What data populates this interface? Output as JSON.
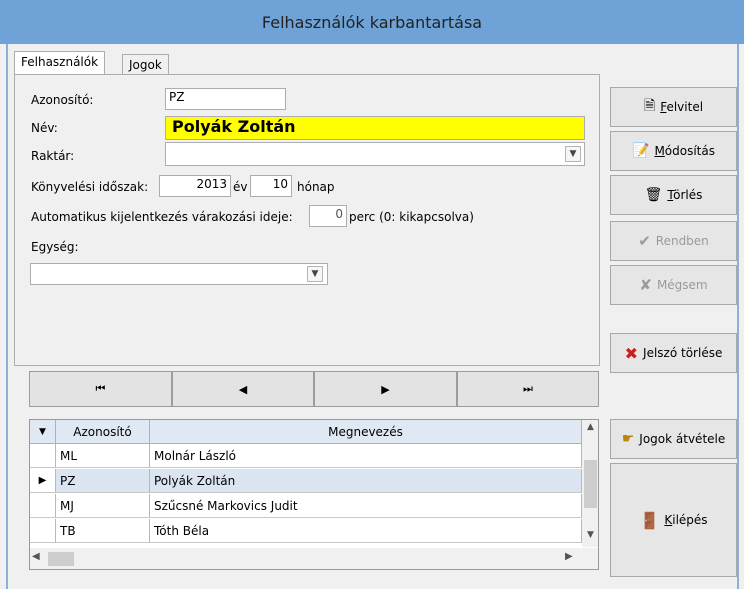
{
  "window": {
    "title": "Felhasználók karbantartása"
  },
  "tabs": {
    "users": "Felhasználók",
    "rights": "Jogok"
  },
  "form": {
    "id_label": "Azonosító:",
    "id_value": "PZ",
    "name_label": "Név:",
    "name_value": "Polyák Zoltán",
    "warehouse_label": "Raktár:",
    "warehouse_value": "",
    "period_label": "Könyvelési időszak:",
    "year_value": "2013",
    "year_unit": "év",
    "month_value": "10",
    "month_unit": "hónap",
    "logout_label": "Automatikus kijelentkezés várakozási ideje:",
    "logout_value": "0",
    "logout_unit": "perc (0: kikapcsolva)",
    "unit_label": "Egység:",
    "unit_value": ""
  },
  "buttons": {
    "add": {
      "u": "F",
      "rest": "elvitel"
    },
    "modify": {
      "u": "M",
      "rest": "ódosítás"
    },
    "delete": {
      "u": "T",
      "rest": "örlés"
    },
    "ok": "Rendben",
    "cancel": "Mégsem",
    "reset_password": "Jelszó törlése",
    "copy_rights": "Jogok átvétele",
    "exit": {
      "u": "K",
      "rest": "ilépés"
    }
  },
  "nav": {
    "first": "⏮",
    "prev": "◀",
    "next": "▶",
    "last": "⏭"
  },
  "grid": {
    "columns": [
      "Azonosító",
      "Megnevezés"
    ],
    "rows": [
      {
        "id": "ML",
        "name": "Molnár László",
        "selected": false
      },
      {
        "id": "PZ",
        "name": "Polyák Zoltán",
        "selected": true
      },
      {
        "id": "MJ",
        "name": "Szűcsné Markovics Judit",
        "selected": false
      },
      {
        "id": "TB",
        "name": "Tóth Béla",
        "selected": false
      }
    ]
  }
}
